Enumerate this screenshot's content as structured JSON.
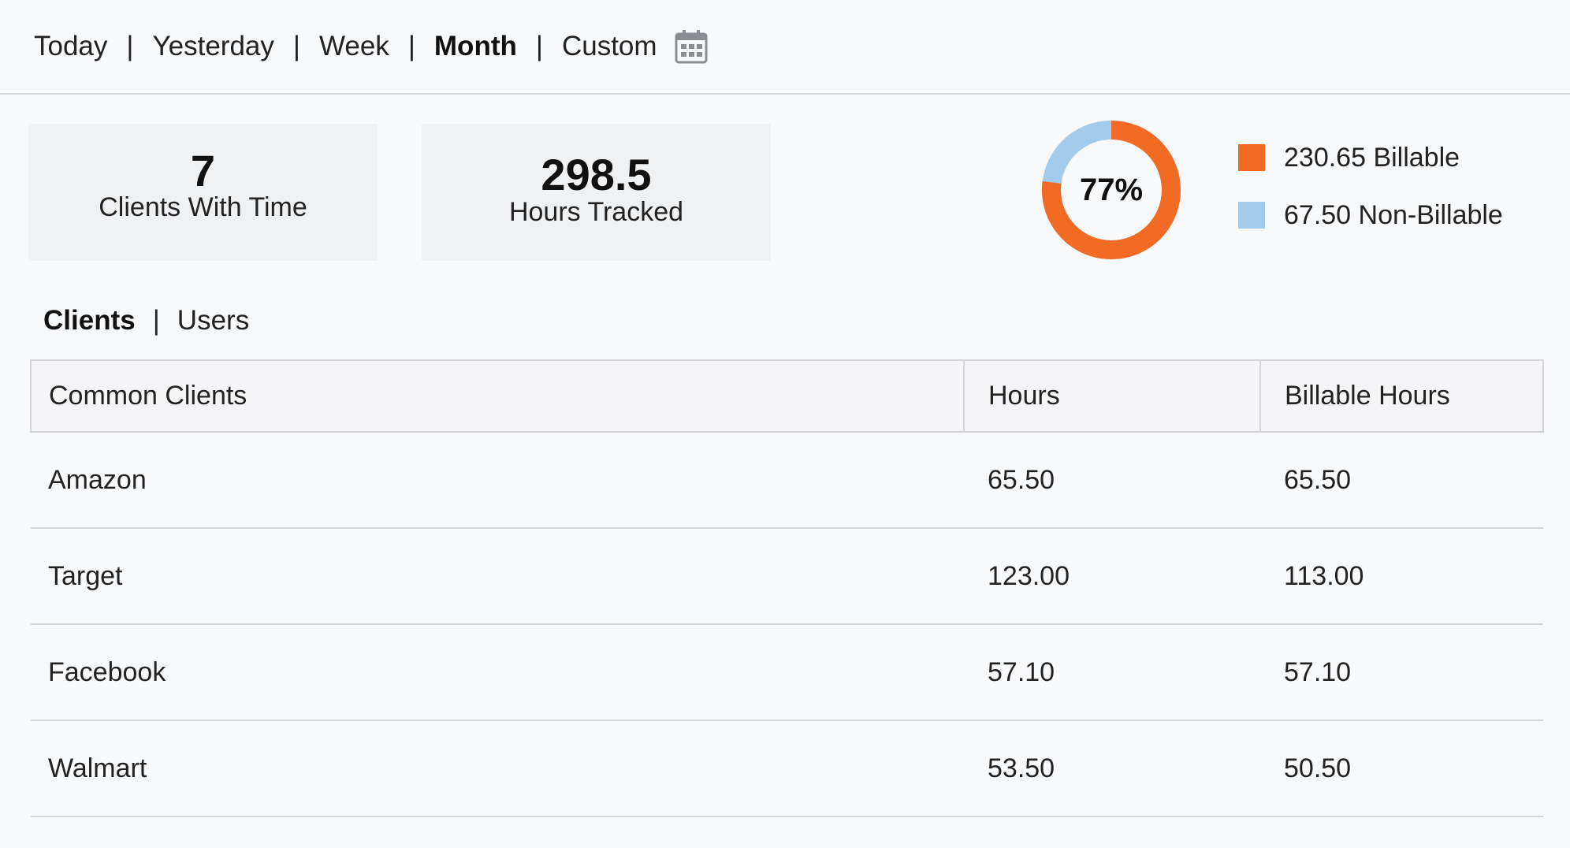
{
  "range_tabs": [
    {
      "label": "Today",
      "active": false
    },
    {
      "label": "Yesterday",
      "active": false
    },
    {
      "label": "Week",
      "active": false
    },
    {
      "label": "Month",
      "active": true
    },
    {
      "label": "Custom",
      "active": false
    }
  ],
  "separator": "|",
  "calendar_icon": "calendar-icon",
  "stats": {
    "clients": {
      "value": "7",
      "label": "Clients With Time"
    },
    "hours": {
      "value": "298.5",
      "label": "Hours Tracked"
    }
  },
  "donut": {
    "percent_label": "77%",
    "billable_fraction": 0.77,
    "colors": {
      "billable": "#f26b25",
      "non_billable": "#a3cbeb"
    }
  },
  "legend": [
    {
      "label": "230.65 Billable",
      "color": "#f26b25"
    },
    {
      "label": "67.50 Non-Billable",
      "color": "#a3cbeb"
    }
  ],
  "sub_tabs": [
    {
      "label": "Clients",
      "active": true
    },
    {
      "label": "Users",
      "active": false
    }
  ],
  "table": {
    "headers": [
      "Common Clients",
      "Hours",
      "Billable Hours"
    ],
    "rows": [
      {
        "client": "Amazon",
        "hours": "65.50",
        "billable": "65.50"
      },
      {
        "client": "Target",
        "hours": "123.00",
        "billable": "113.00"
      },
      {
        "client": "Facebook",
        "hours": "57.10",
        "billable": "57.10"
      },
      {
        "client": "Walmart",
        "hours": "53.50",
        "billable": "50.50"
      }
    ]
  }
}
